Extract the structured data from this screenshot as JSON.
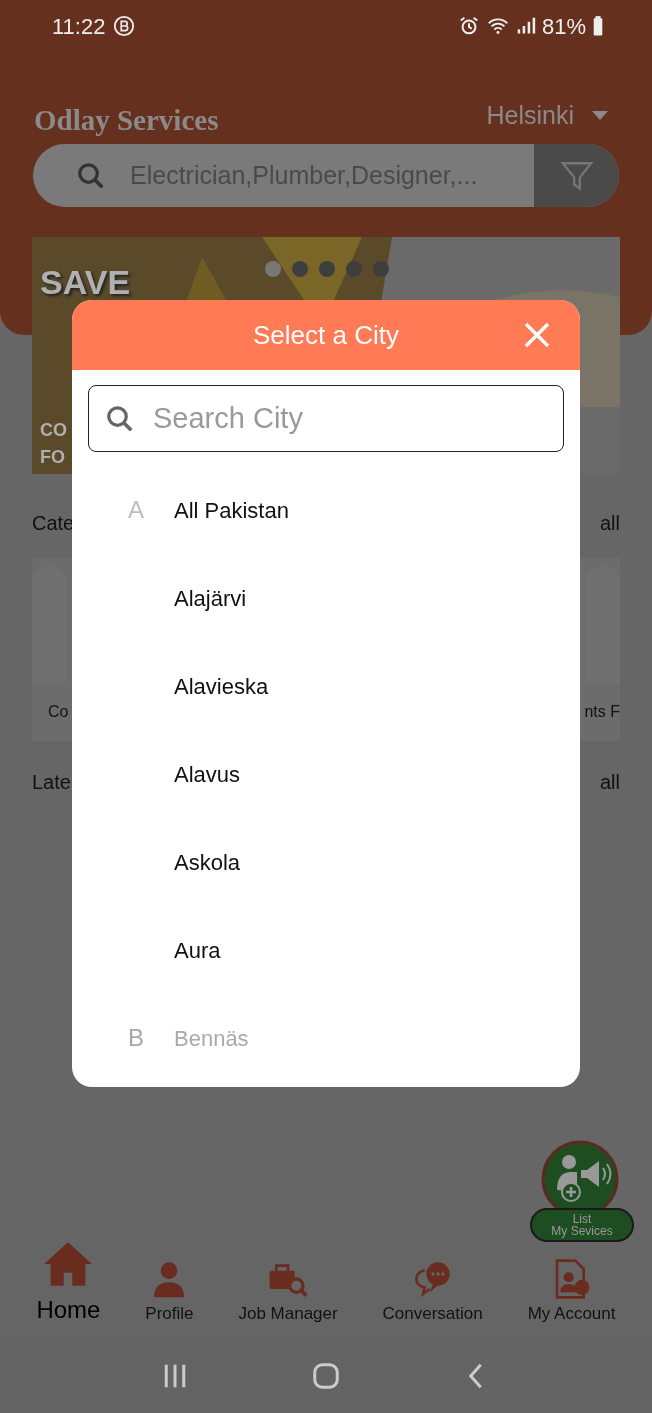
{
  "status_bar": {
    "time": "11:22",
    "battery": "81%"
  },
  "header": {
    "title": "Odlay Services",
    "city": "Helsinki",
    "search_placeholder": "Electrician,Plumber,Designer,..."
  },
  "banner": {
    "headline": "SAVE",
    "line_1": "CO",
    "line_2": "FO",
    "dots": [
      {
        "selected": true
      },
      {
        "selected": false
      },
      {
        "selected": false
      },
      {
        "selected": false
      },
      {
        "selected": false
      }
    ]
  },
  "categories": {
    "heading": "Cate",
    "view_all": "all",
    "cards": [
      {
        "label": "Co"
      },
      {
        "label": "nts F"
      }
    ]
  },
  "latest": {
    "heading": "Late",
    "view_all": "all"
  },
  "city_dialog": {
    "title": "Select a City",
    "search_placeholder": "Search City",
    "cities": [
      {
        "letter": "A",
        "name": "All Pakistan",
        "faded": false
      },
      {
        "name": "Alajärvi",
        "faded": false
      },
      {
        "name": "Alavieska",
        "faded": false
      },
      {
        "name": "Alavus",
        "faded": false
      },
      {
        "name": "Askola",
        "faded": false
      },
      {
        "name": "Aura",
        "faded": false
      },
      {
        "letter": "B",
        "name": "Bennäs",
        "faded": true
      }
    ]
  },
  "fab": {
    "lines": [
      "List",
      "My Sevices"
    ]
  },
  "bottom_nav": [
    {
      "label": "Home",
      "selected": true
    },
    {
      "label": "Profile",
      "selected": false
    },
    {
      "label": "Job Manager",
      "selected": false
    },
    {
      "label": "Conversation",
      "selected": false
    },
    {
      "label": "My Account",
      "selected": false
    }
  ]
}
